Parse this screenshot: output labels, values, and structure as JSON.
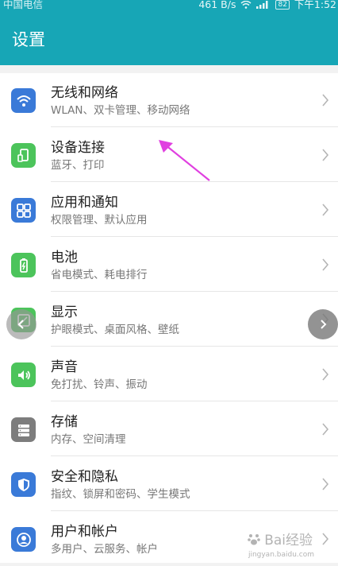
{
  "status_bar": {
    "carrier": "中国电信",
    "speed": "461 B/s",
    "battery": "82",
    "time": "下午1:52"
  },
  "header": {
    "title": "设置"
  },
  "items": [
    {
      "title": "无线和网络",
      "subtitle": "WLAN、双卡管理、移动网络",
      "icon": "wifi-icon"
    },
    {
      "title": "设备连接",
      "subtitle": "蓝牙、打印",
      "icon": "device-connection-icon"
    },
    {
      "title": "应用和通知",
      "subtitle": "权限管理、默认应用",
      "icon": "apps-grid-icon"
    },
    {
      "title": "电池",
      "subtitle": "省电模式、耗电排行",
      "icon": "battery-icon"
    },
    {
      "title": "显示",
      "subtitle": "护眼模式、桌面风格、壁纸",
      "icon": "display-icon"
    },
    {
      "title": "声音",
      "subtitle": "免打扰、铃声、振动",
      "icon": "sound-icon"
    },
    {
      "title": "存储",
      "subtitle": "内存、空间清理",
      "icon": "storage-icon"
    },
    {
      "title": "安全和隐私",
      "subtitle": "指纹、锁屏和密码、学生模式",
      "icon": "shield-icon"
    },
    {
      "title": "用户和帐户",
      "subtitle": "多用户、云服务、帐户",
      "icon": "user-icon"
    }
  ],
  "watermark": {
    "text": "Bai经验",
    "sub": "jingyan.baidu.com"
  },
  "colors": {
    "header": "#17a6b6",
    "blue_icon": "#3a7ad8",
    "green_icon": "#4cc45b",
    "gray_icon": "#7d7d7d",
    "annotation_arrow": "#e040e0"
  }
}
